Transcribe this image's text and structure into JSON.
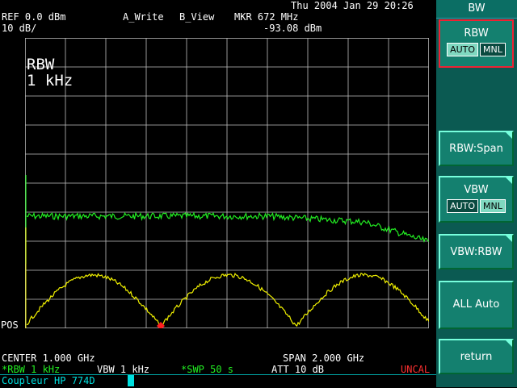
{
  "header": {
    "datetime": "Thu 2004 Jan 29 20:26",
    "ref": "REF 0.0 dBm",
    "scale": "10 dB/",
    "trace_a": "A_Write",
    "trace_b": "B_View",
    "marker": "MKR 672 MHz",
    "marker_level": "-93.08 dBm"
  },
  "plot": {
    "rbw_title": "RBW",
    "rbw_value": "1 kHz",
    "pos_label": "POS"
  },
  "footer": {
    "center": "CENTER 1.000 GHz",
    "span": "SPAN 2.000 GHz",
    "rbw": "*RBW 1 kHz",
    "vbw": "VBW 1 kHz",
    "swp": "*SWP 50 s",
    "att": "ATT 10 dB",
    "uncal": "UNCAL",
    "status": "Coupleur HP 774D"
  },
  "softkeys": {
    "menu_title": "BW",
    "rbw": {
      "label": "RBW",
      "auto": "AUTO",
      "mnl": "MNL"
    },
    "rbw_span": "RBW:Span",
    "vbw": {
      "label": "VBW",
      "auto": "AUTO",
      "mnl": "MNL"
    },
    "vbw_rbw": "VBW:RBW",
    "all_auto": "ALL Auto",
    "return": "return"
  },
  "colors": {
    "grid": "#bfbfbf",
    "trace_green": "#22ee22",
    "trace_yellow": "#f0f000",
    "marker": "#ff2020",
    "uncal": "#ff3030",
    "cyan": "#00e0e0"
  }
}
